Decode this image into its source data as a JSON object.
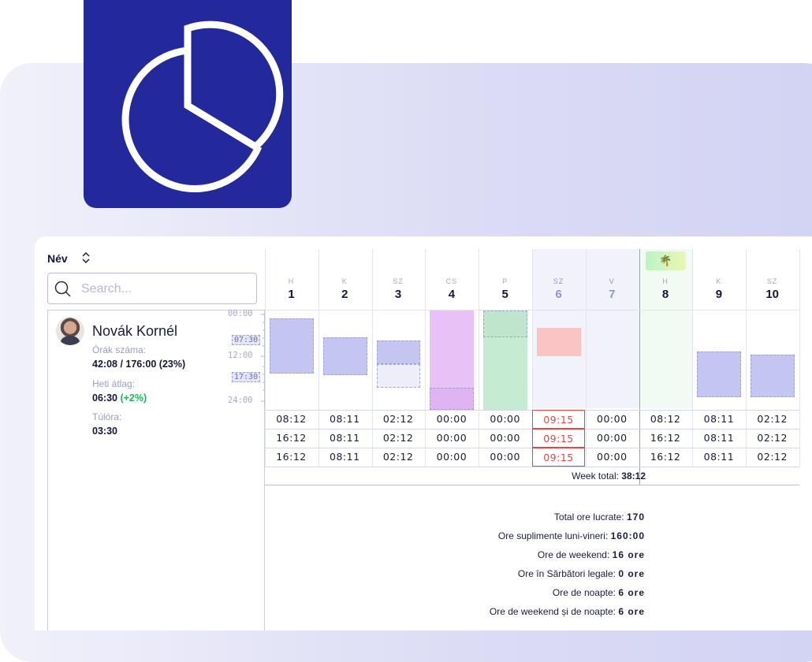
{
  "colors": {
    "brand": "#23299b",
    "accent_purple": "#c4c5f1",
    "magenta": "#e8c1f6",
    "green": "#c5ecd2",
    "alert_red": "#e04848",
    "positive": "#22b35a"
  },
  "logo": {
    "icon": "pie-chart-icon"
  },
  "employee_list": {
    "header_label": "Név",
    "sort_icon": "sort-updown-icon",
    "search_placeholder": "Search...",
    "employee": {
      "name": "Novák Kornél",
      "hours_label": "Órák száma:",
      "hours_value": "42:08 / 176:00 (23%)",
      "weekly_avg_label": "Heti átlag:",
      "weekly_avg_value": "06:30",
      "weekly_avg_delta": "(+2%)",
      "overtime_label": "Túlóra:",
      "overtime_value": "03:30"
    }
  },
  "timeline_axis": {
    "labels": [
      "00:00",
      "12:00",
      "24:00"
    ],
    "markers": [
      "07:30",
      "17:30"
    ]
  },
  "days": [
    {
      "abbr": "H",
      "num": "1",
      "weekend": false
    },
    {
      "abbr": "K",
      "num": "2",
      "weekend": false
    },
    {
      "abbr": "SZ",
      "num": "3",
      "weekend": false
    },
    {
      "abbr": "CS",
      "num": "4",
      "weekend": false
    },
    {
      "abbr": "P",
      "num": "5",
      "weekend": false
    },
    {
      "abbr": "SZ",
      "num": "6",
      "weekend": true
    },
    {
      "abbr": "V",
      "num": "7",
      "weekend": true
    },
    {
      "abbr": "H",
      "num": "8",
      "weekend": false,
      "holiday_icon": "palm-tree-icon"
    },
    {
      "abbr": "K",
      "num": "9",
      "weekend": false
    },
    {
      "abbr": "SZ",
      "num": "10",
      "weekend": false
    }
  ],
  "rows": [
    [
      "08:12",
      "08:11",
      "02:12",
      "00:00",
      "00:00",
      "09:15",
      "00:00",
      "08:12",
      "08:11",
      "02:12"
    ],
    [
      "16:12",
      "08:11",
      "02:12",
      "00:00",
      "00:00",
      "09:15",
      "00:00",
      "16:12",
      "08:11",
      "02:12"
    ],
    [
      "16:12",
      "08:11",
      "02:12",
      "00:00",
      "00:00",
      "09:15",
      "00:00",
      "16:12",
      "08:11",
      "02:12"
    ]
  ],
  "week_total": {
    "label": "Week total:",
    "value": "38:12"
  },
  "summary": [
    {
      "label": "Total ore lucrate:",
      "value": "170"
    },
    {
      "label": "Ore suplimente luni-vineri:",
      "value": "160:00"
    },
    {
      "label": "Ore de weekend:",
      "value": "16 ore"
    },
    {
      "label": "Ore în Sărbători legale:",
      "value": "0 ore"
    },
    {
      "label": "Ore de noapte:",
      "value": "6 ore"
    },
    {
      "label": "Ore de weekend și de noapte:",
      "value": "6 ore"
    }
  ]
}
